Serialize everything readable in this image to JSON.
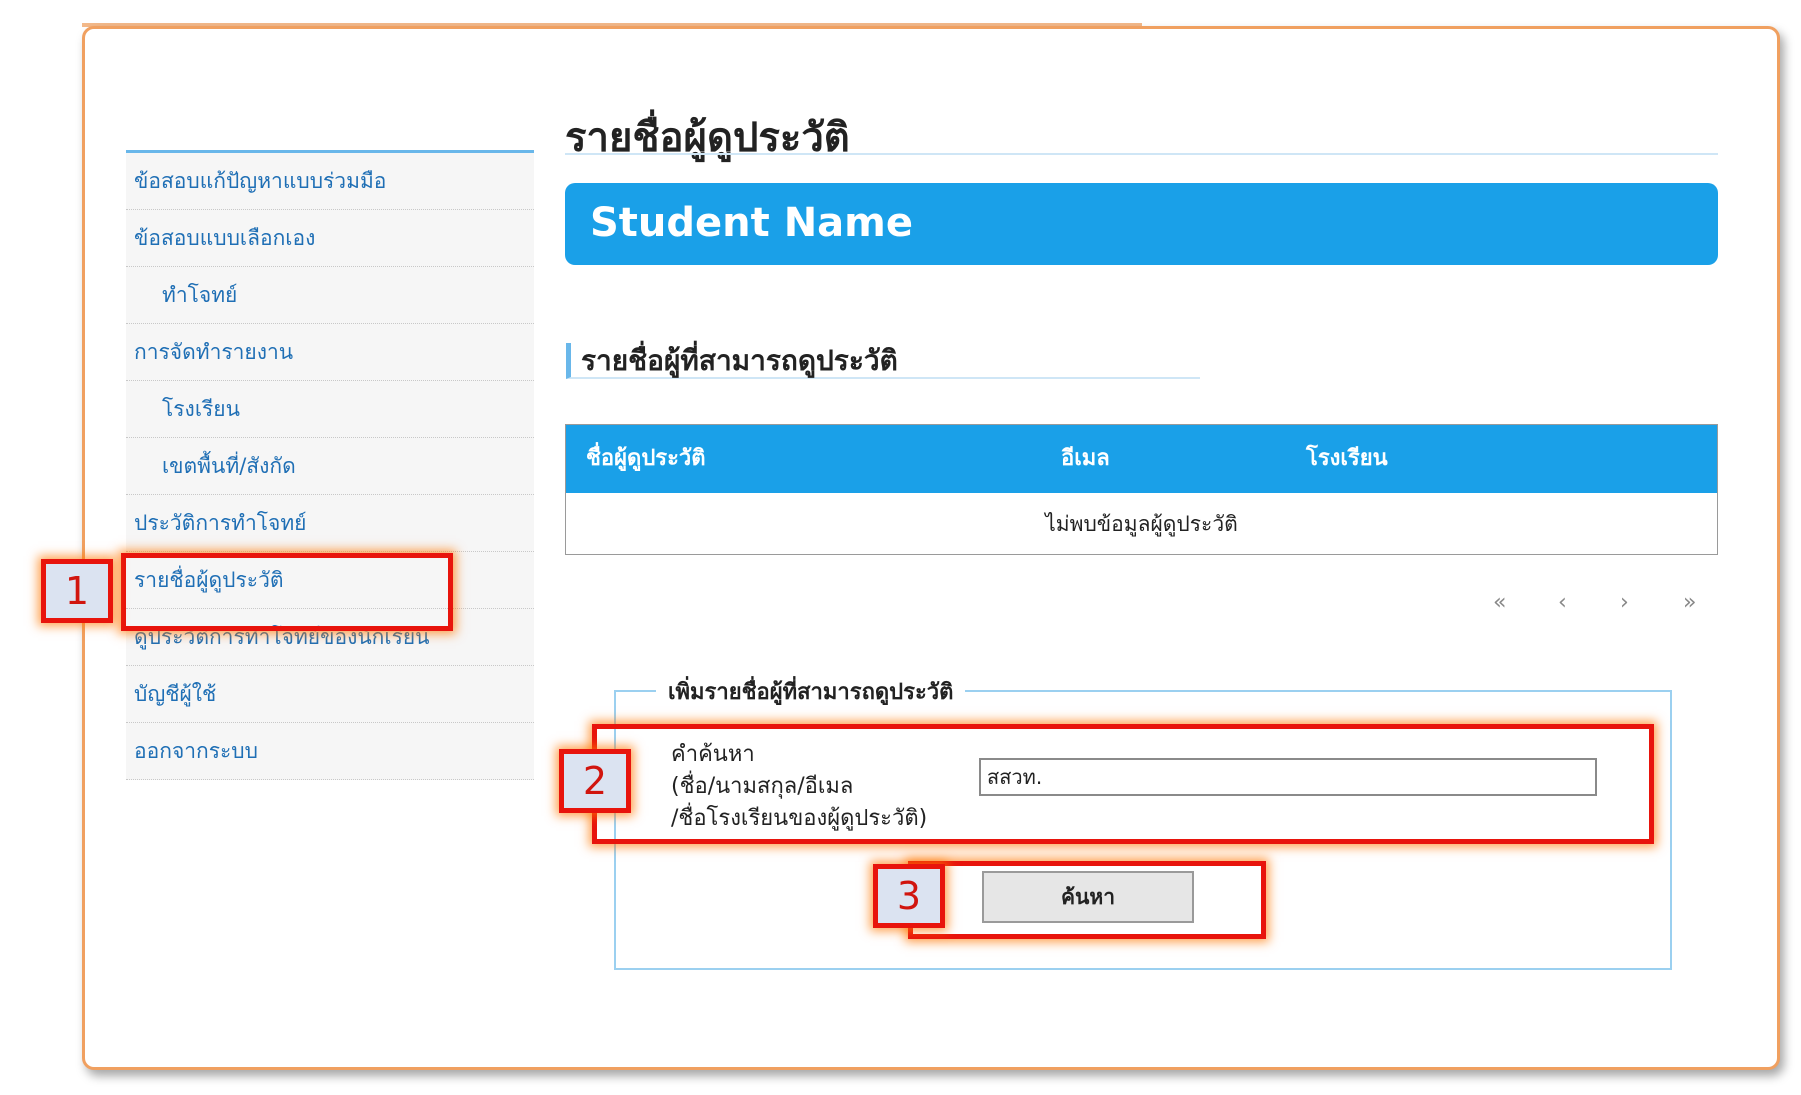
{
  "sidebar": {
    "items": [
      {
        "label": "ข้อสอบแก้ปัญหาแบบร่วมมือ"
      },
      {
        "label": "ข้อสอบแบบเลือกเอง"
      },
      {
        "label": "ทำโจทย์"
      },
      {
        "label": "การจัดทำรายงาน"
      },
      {
        "label": "โรงเรียน"
      },
      {
        "label": "เขตพื้นที่/สังกัด"
      },
      {
        "label": "ประวัติการทำโจทย์"
      },
      {
        "label": "รายชื่อผู้ดูประวัติ"
      },
      {
        "label": "ดูประวัติการทำโจทย์ของนักเรียน"
      },
      {
        "label": "บัญชีผู้ใช้"
      },
      {
        "label": "ออกจากระบบ"
      }
    ]
  },
  "main": {
    "page_title": "รายชื่อผู้ดูประวัติ",
    "banner": "Student Name",
    "section_title": "รายชื่อผู้ที่สามารถดูประวัติ",
    "table": {
      "columns": [
        "ชื่อผู้ดูประวัติ",
        "อีเมล",
        "โรงเรียน"
      ],
      "empty_message": "ไม่พบข้อมูลผู้ดูประวัติ"
    },
    "pager": {
      "first": "«",
      "prev": "‹",
      "next": "›",
      "last": "»"
    }
  },
  "add_form": {
    "legend": "เพิ่มรายชื่อผู้ที่สามารถดูประวัติ",
    "label_line1": "คำค้นหา",
    "label_line2": "(ชื่อ/นามสกุล/อีเมล",
    "label_line3": "/ชื่อโรงเรียนของผู้ดูประวัติ)",
    "search_value": "สสวท.",
    "search_button": "ค้นหา"
  },
  "annotations": {
    "step1": "1",
    "step2": "2",
    "step3": "3",
    "color": "#e8140c"
  }
}
